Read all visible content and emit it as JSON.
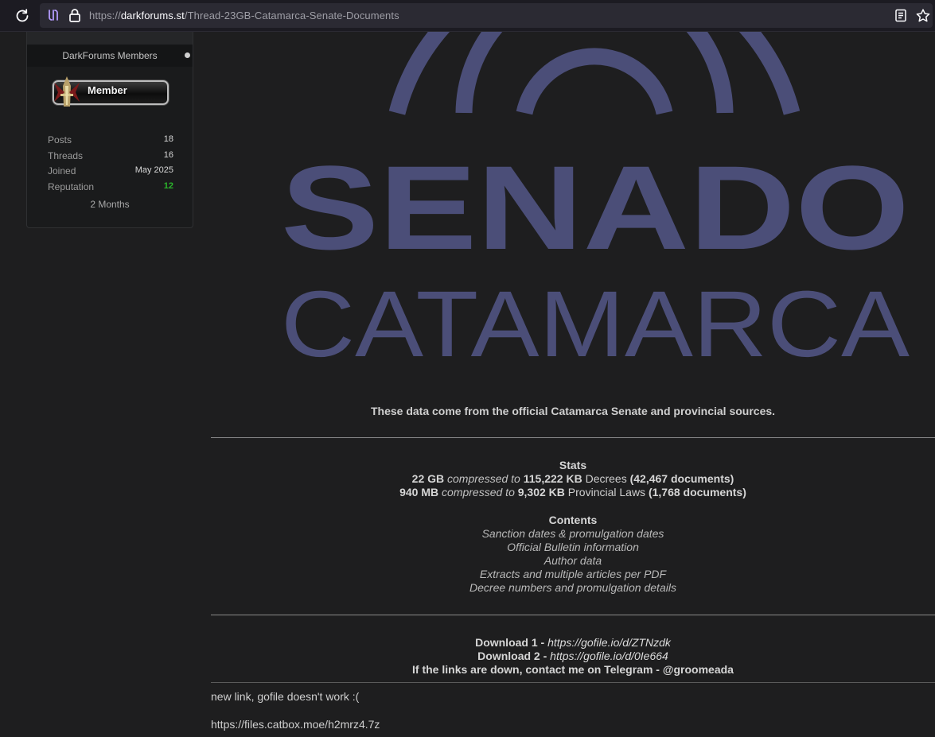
{
  "browser": {
    "url_scheme": "https://",
    "url_host": "darkforums.st",
    "url_path": "/Thread-23GB-Catamarca-Senate-Documents"
  },
  "sidebar": {
    "group_title": "DarkForums Members",
    "badge_label": "Member",
    "stats": [
      {
        "label": "Posts",
        "value": "18"
      },
      {
        "label": "Threads",
        "value": "16"
      },
      {
        "label": "Joined",
        "value": "May 2025"
      },
      {
        "label": "Reputation",
        "value": "12"
      }
    ],
    "time_spent": "2 Months"
  },
  "banner": {
    "line1": "SENADO",
    "line2": "CATAMARCA",
    "color": "#4b4e78"
  },
  "post": {
    "lead": "These data come from the official Catamarca Senate and provincial sources.",
    "stats_heading": "Stats",
    "stats_line1": {
      "size": "22 GB",
      "mid": "compressed to",
      "compressed": "115,222 KB",
      "kind": "Decrees",
      "count": "(42,467 documents)"
    },
    "stats_line2": {
      "size": "940 MB",
      "mid": "compressed to",
      "compressed": "9,302 KB",
      "kind": "Provincial Laws",
      "count": "(1,768 documents)"
    },
    "contents_heading": "Contents",
    "contents": [
      "Sanction dates & promulgation dates",
      "Official Bulletin information",
      "Author data",
      "Extracts and multiple articles per PDF",
      "Decree numbers and promulgation details"
    ],
    "download1_label": "Download 1 - ",
    "download1_link": "https://gofile.io/d/ZTNzdk",
    "download2_label": "Download 2 - ",
    "download2_link": "https://gofile.io/d/0Ie664",
    "contact": "If the links are down, contact me on Telegram - @groomeada"
  },
  "reply": {
    "line1": "new link, gofile doesn't work :(",
    "line2": "https://files.catbox.moe/h2mrz4.7z"
  }
}
